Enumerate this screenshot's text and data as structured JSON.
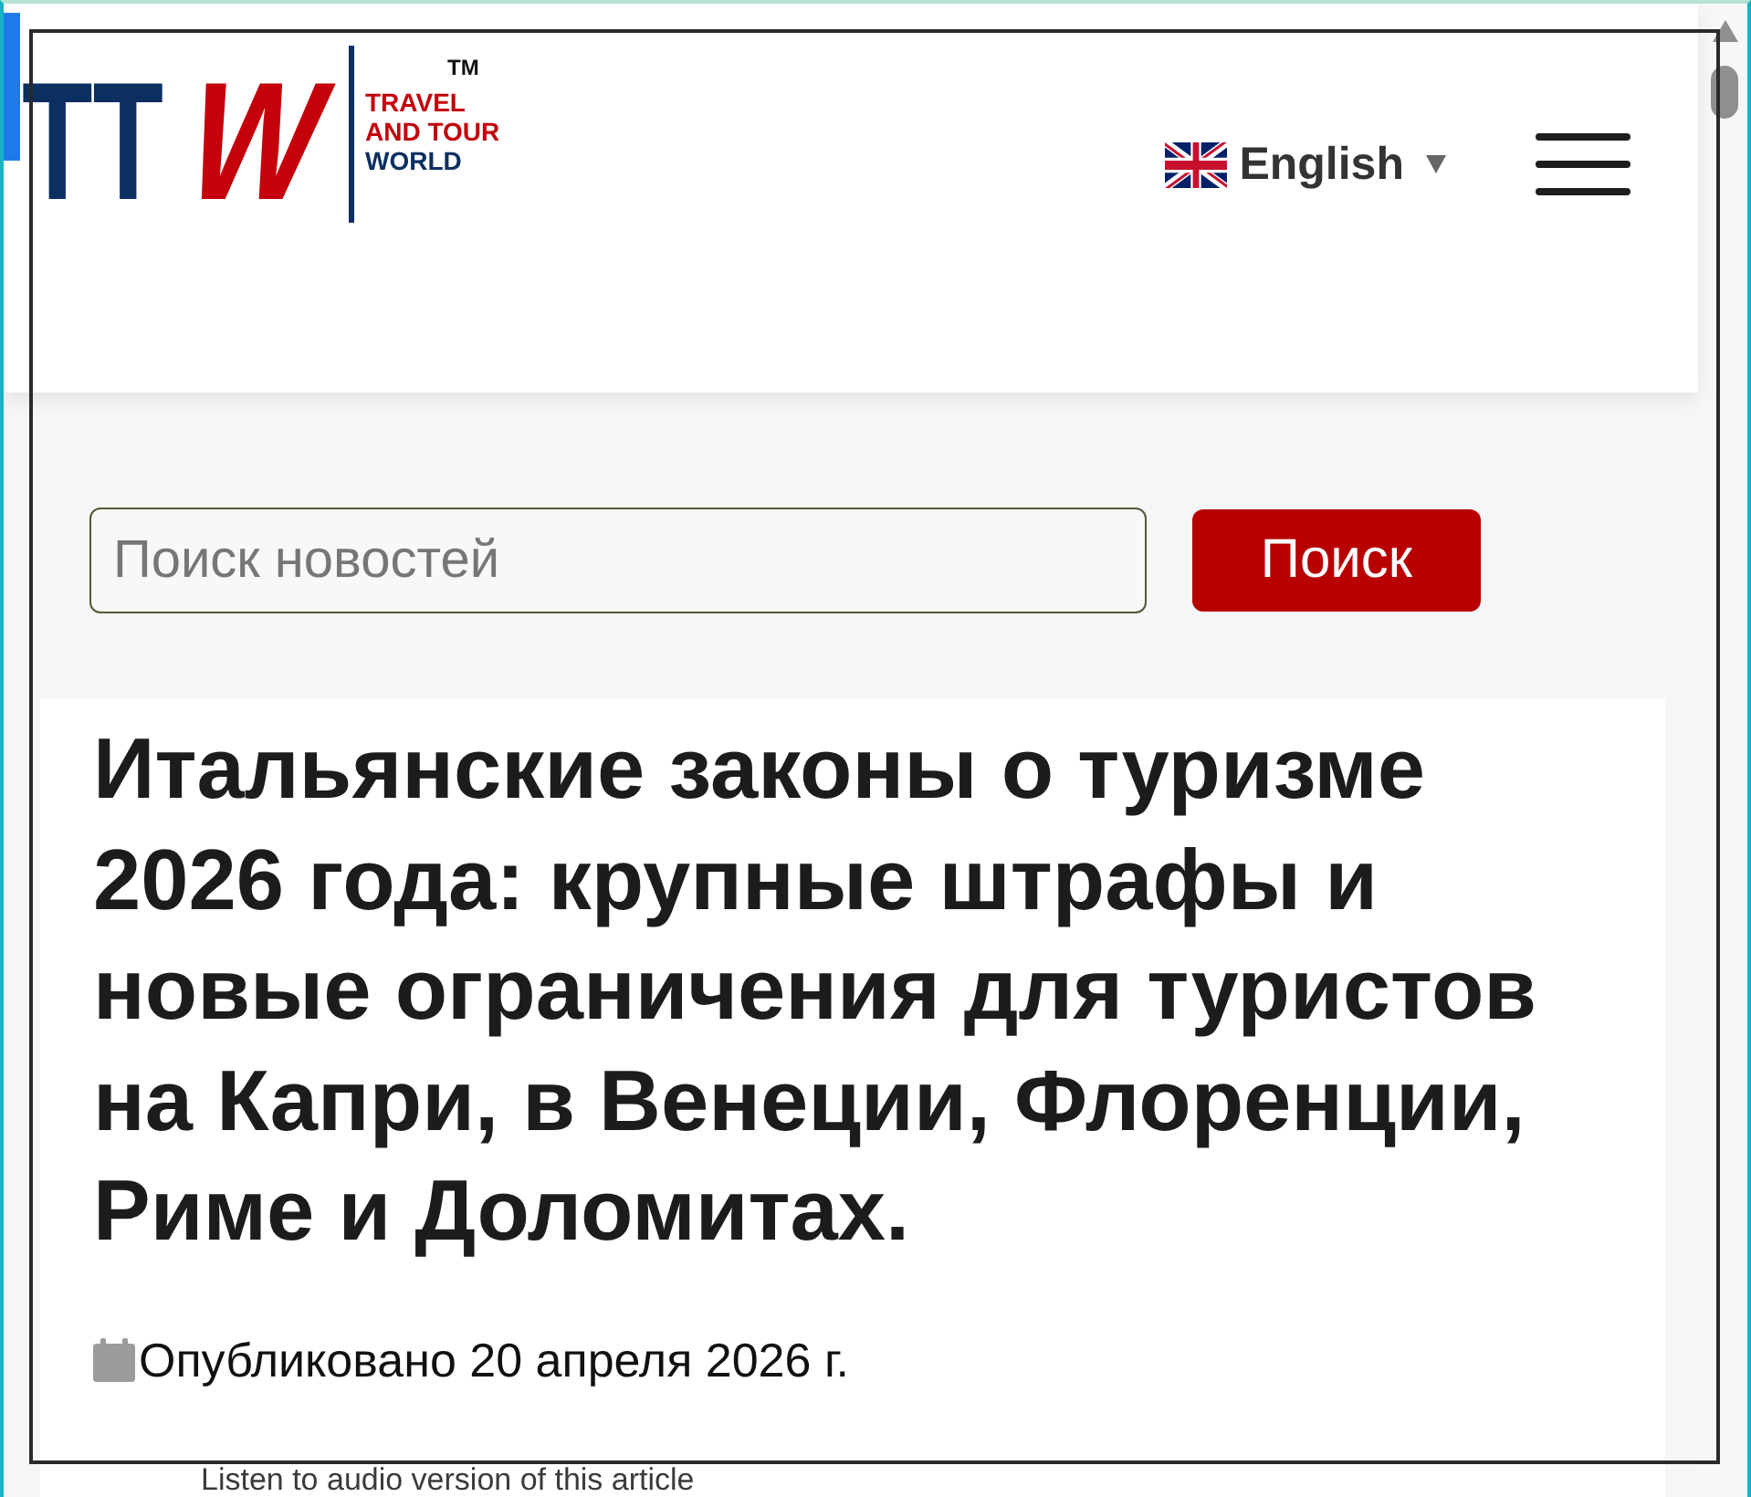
{
  "header": {
    "logo": {
      "letters": "TT",
      "accent_letter": "W",
      "trademark": "TM",
      "tagline": [
        "TRAVEL",
        "AND TOUR",
        "WORLD"
      ]
    },
    "language": {
      "label": "English"
    }
  },
  "search": {
    "placeholder": "Поиск новостей",
    "button": "Поиск"
  },
  "article": {
    "title": "Итальянские законы о туризме 2026 года: крупные штрафы и новые ограничения для туристов на Капри, в Венеции, Флоренции, Риме и Доломитах.",
    "published": "Опубликовано 20 апреля 2026 г.",
    "audio_prompt": "Listen to audio version of this article"
  }
}
